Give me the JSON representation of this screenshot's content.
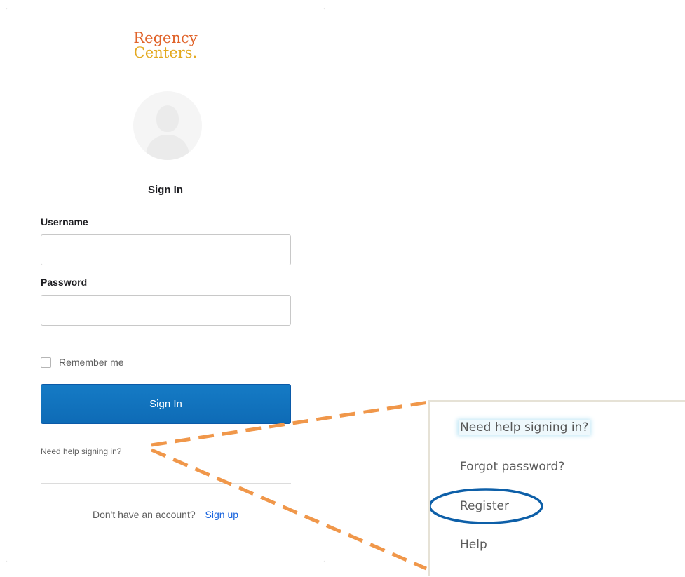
{
  "logo": {
    "line1": "Regency",
    "line2": "Centers."
  },
  "form": {
    "title": "Sign In",
    "username_label": "Username",
    "username_value": "",
    "password_label": "Password",
    "password_value": "",
    "remember_label": "Remember me",
    "remember_checked": false,
    "submit_label": "Sign In",
    "help_link": "Need help signing in?",
    "no_account_text": "Don't have an account?",
    "signup_link": "Sign up"
  },
  "help_popup": {
    "items": [
      {
        "label": "Need help signing in?"
      },
      {
        "label": "Forgot password?"
      },
      {
        "label": "Register"
      },
      {
        "label": "Help"
      }
    ]
  },
  "colors": {
    "primary_button": "#0e6bb6",
    "link": "#1662dd",
    "logo_line1": "#e0632a",
    "logo_line2": "#e3a81e",
    "callout_dashes": "#f0974a",
    "register_highlight": "#0d5fa8"
  },
  "icons": {
    "avatar": "user-silhouette-icon"
  }
}
